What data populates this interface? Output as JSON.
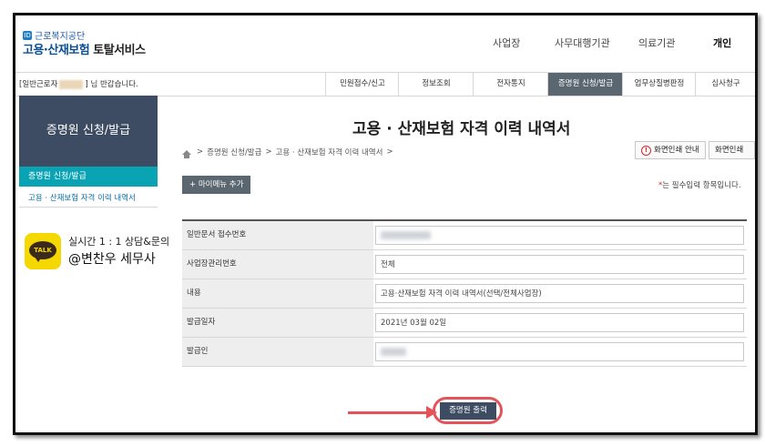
{
  "header": {
    "org_name": "근로복지공단",
    "logo_mark": "ID",
    "service_name_part1": "고용·산재보험",
    "service_name_part2": "토탈서비스",
    "top_nav": [
      "사업장",
      "사무대행기관",
      "의료기관",
      "개인"
    ],
    "active_top_nav": "개인"
  },
  "menubar": {
    "greeting_prefix": "[일반근로자",
    "greeting_suffix": "] 님 반갑습니다.",
    "items": [
      "민원접수/신고",
      "정보조회",
      "전자통지",
      "증명원 신청/발급",
      "업무상질병판정",
      "심사청구"
    ],
    "active_item": "증명원 신청/발급"
  },
  "sidebar": {
    "title": "증명원 신청/발급",
    "sub_active": "증명원 신청/발급",
    "item": "고용 · 산재보험 자격 이력 내역서"
  },
  "talk": {
    "badge": "TALK",
    "line1": "실시간 1 : 1 상담&문의",
    "line2": "@변찬우 세무사"
  },
  "main": {
    "title": "고용 · 산재보험 자격 이력 내역서",
    "breadcrumb": [
      "증명원 신청/발급",
      "고용 · 산재보험 자격 이력 내역서"
    ],
    "btn_print_guide": "화면인쇄 안내",
    "btn_print": "화면인쇄",
    "btn_mymenu": "+ 마이메뉴 추가",
    "required_note": "는 필수입력 항목입니다.",
    "rows": [
      {
        "label": "일반문서 접수번호",
        "value": ""
      },
      {
        "label": "사업장관리번호",
        "value": "전체"
      },
      {
        "label": "내용",
        "value": "고용·산재보험 자격 이력 내역서(선택/전체사업장)"
      },
      {
        "label": "발급일자",
        "value": "2021년 03월 02일"
      },
      {
        "label": "발급인",
        "value": ""
      }
    ],
    "print_button": "증명원 출력"
  },
  "colors": {
    "accent_dark": "#3d4c62",
    "teal": "#0aa3b4",
    "highlight": "#e4535a",
    "active_menu": "#5a6670"
  }
}
